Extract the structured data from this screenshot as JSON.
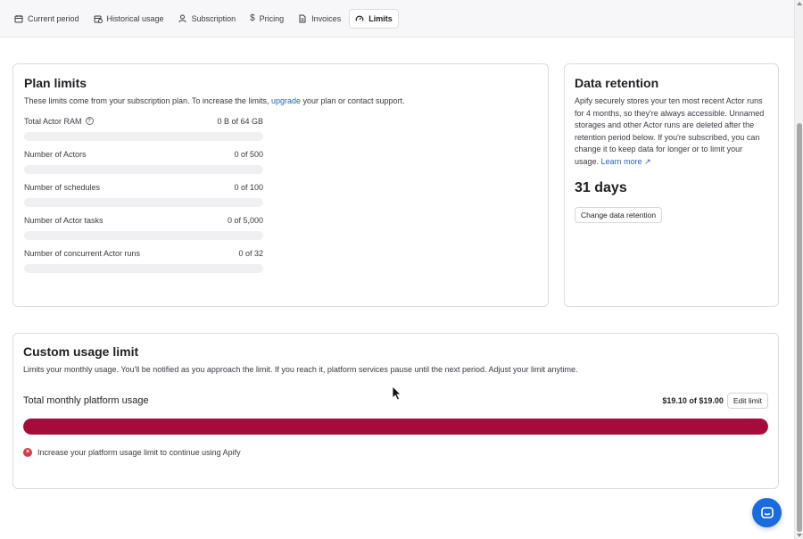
{
  "tabs": [
    {
      "label": "Current period",
      "icon": "calendar-icon",
      "active": false
    },
    {
      "label": "Historical usage",
      "icon": "calendar-clock-icon",
      "active": false
    },
    {
      "label": "Subscription",
      "icon": "user-icon",
      "active": false
    },
    {
      "label": "Pricing",
      "icon": "dollar-icon",
      "active": false
    },
    {
      "label": "Invoices",
      "icon": "document-icon",
      "active": false
    },
    {
      "label": "Limits",
      "icon": "gauge-icon",
      "active": true
    }
  ],
  "plan_limits": {
    "title": "Plan limits",
    "desc_before": "These limits come from your subscription plan. To increase the limits, ",
    "desc_link": "upgrade",
    "desc_after": " your plan or contact support.",
    "rows": [
      {
        "label": "Total Actor RAM",
        "value": "0 B of 64 GB",
        "info": true,
        "fill_fraction": 0
      },
      {
        "label": "Number of Actors",
        "value": "0 of 500",
        "info": false,
        "fill_fraction": 0
      },
      {
        "label": "Number of schedules",
        "value": "0 of 100",
        "info": false,
        "fill_fraction": 0
      },
      {
        "label": "Number of Actor tasks",
        "value": "0 of 5,000",
        "info": false,
        "fill_fraction": 0
      },
      {
        "label": "Number of concurrent Actor runs",
        "value": "0 of 32",
        "info": false,
        "fill_fraction": 0
      }
    ]
  },
  "data_retention": {
    "title": "Data retention",
    "desc": "Apify securely stores your ten most recent Actor runs for 4 months, so they're always accessible. Unnamed storages and other Actor runs are deleted after the retention period below. If you're subscribed, you can change it to keep data for longer or to limit your usage.",
    "learn_more": "Learn more ↗",
    "days": "31 days",
    "button_label": "Change data retention"
  },
  "custom_usage": {
    "title": "Custom usage limit",
    "desc": "Limits your monthly usage. You'll be notified as you approach the limit. If you reach it, platform services pause until the next period. Adjust your limit anytime.",
    "usage_label": "Total monthly platform usage",
    "usage_value": "$19.10 of $19.00",
    "edit_button": "Edit limit",
    "fill_fraction": 1.0,
    "warning": "Increase your platform usage limit to continue using Apify"
  },
  "colors": {
    "accent_link": "#1f63cc",
    "usage_bar": "#a50c3b",
    "warning": "#d93a46",
    "chat_bubble": "#1a6be0"
  }
}
